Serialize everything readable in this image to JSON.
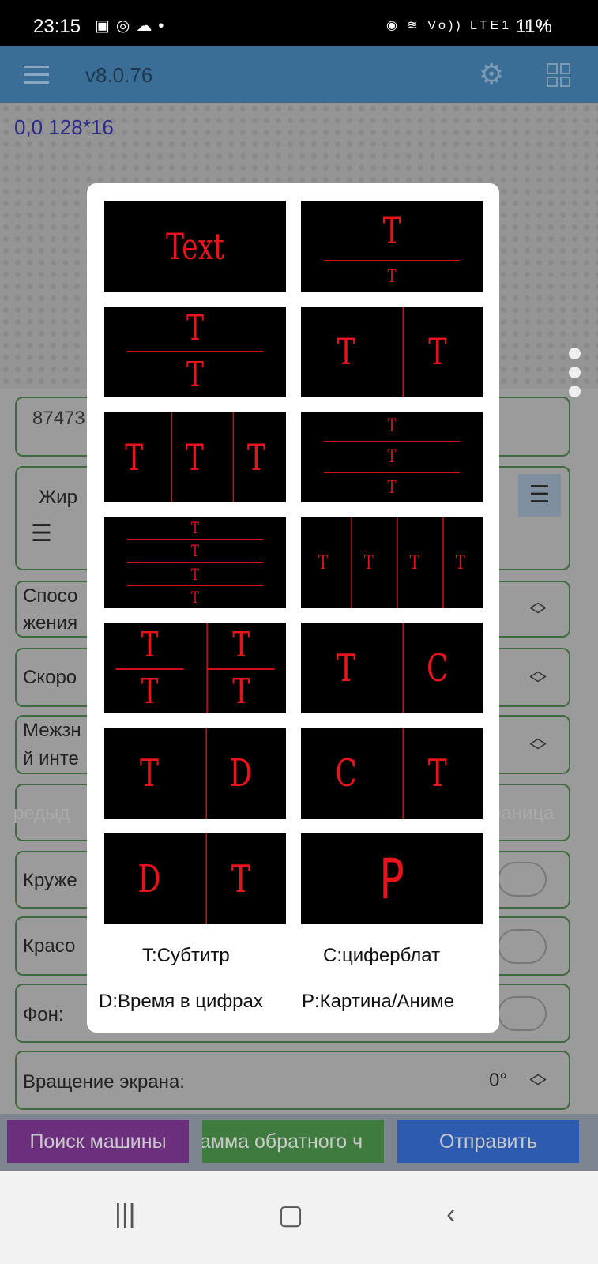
{
  "status_bar": {
    "time": "23:15",
    "notif_icons": [
      "image-icon",
      "instagram-icon",
      "cloud-icon",
      "dot-icon"
    ],
    "network": "Vo)) LTE1",
    "battery": "11%"
  },
  "app_bar": {
    "version": "v8.0.76",
    "icons": [
      "menu-icon",
      "gear-icon",
      "grid-icon"
    ]
  },
  "canvas": {
    "coords": "0,0 128*16"
  },
  "form": {
    "text_value": "87473",
    "font_label": "Жир",
    "mode_label_1": "Спосо",
    "mode_label_2": "жения",
    "speed_label": "Скоро",
    "interval_label_1": "Межзн",
    "interval_label_2": "й инте",
    "prev_label": "редыд",
    "next_label": "раница",
    "lace_label": "Круже",
    "colorful_label": "Красо",
    "bg_label": "Фон:",
    "rotation_label": "Вращение экрана:",
    "rotation_value": "0°"
  },
  "bottom_buttons": {
    "search": "Поиск машины",
    "countdown": "амма обратного ч",
    "send": "Отправить",
    "colors": {
      "search": "#6b2f7e",
      "countdown": "#3f7a3f",
      "send": "#2c5bb0"
    }
  },
  "modal": {
    "tiles": [
      {
        "letters": [
          "Text"
        ]
      },
      {
        "letters": [
          "T",
          "T"
        ]
      },
      {
        "letters": [
          "T",
          "T"
        ]
      },
      {
        "letters": [
          "T",
          "T"
        ]
      },
      {
        "letters": [
          "T",
          "T",
          "T"
        ]
      },
      {
        "letters": [
          "T",
          "T",
          "T"
        ]
      },
      {
        "letters": [
          "T",
          "T",
          "T",
          "T"
        ]
      },
      {
        "letters": [
          "T",
          "T",
          "T",
          "T"
        ]
      },
      {
        "letters": [
          "T",
          "T",
          "T",
          "T"
        ]
      },
      {
        "letters": [
          "T",
          "C"
        ]
      },
      {
        "letters": [
          "T",
          "D"
        ]
      },
      {
        "letters": [
          "C",
          "T"
        ]
      },
      {
        "letters": [
          "D",
          "T"
        ]
      },
      {
        "letters": [
          "P"
        ]
      }
    ],
    "legend": {
      "t": "T:Субтитр",
      "c": "C:циферблат",
      "d": "D:Время в цифрах",
      "p": "P:Картина/Аниме"
    },
    "accent_color": "#e8141c"
  }
}
